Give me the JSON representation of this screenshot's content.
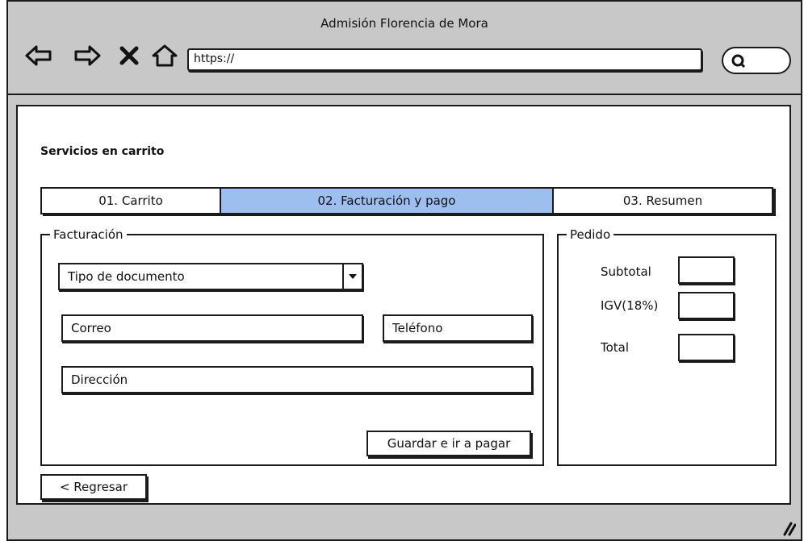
{
  "window": {
    "title": "Admisión  Florencia de Mora",
    "url": "https://"
  },
  "page": {
    "title": "Servicios en carrito"
  },
  "tabs": [
    {
      "label": "01. Carrito",
      "active": false
    },
    {
      "label": "02. Facturación y pago",
      "active": true
    },
    {
      "label": "03. Resumen",
      "active": false
    }
  ],
  "billing": {
    "legend": "Facturación",
    "document_type": "Tipo de documento",
    "email": "Correo",
    "phone": "Teléfono",
    "address": "Dirección",
    "submit_label": "Guardar e ir a pagar"
  },
  "order": {
    "legend": "Pedido",
    "subtotal_label": "Subtotal",
    "tax_label": "IGV(18%)",
    "total_label": "Total"
  },
  "back_label": "< Regresar",
  "colors": {
    "active_tab": "#9dbff0",
    "chrome": "#c8c8c8"
  }
}
